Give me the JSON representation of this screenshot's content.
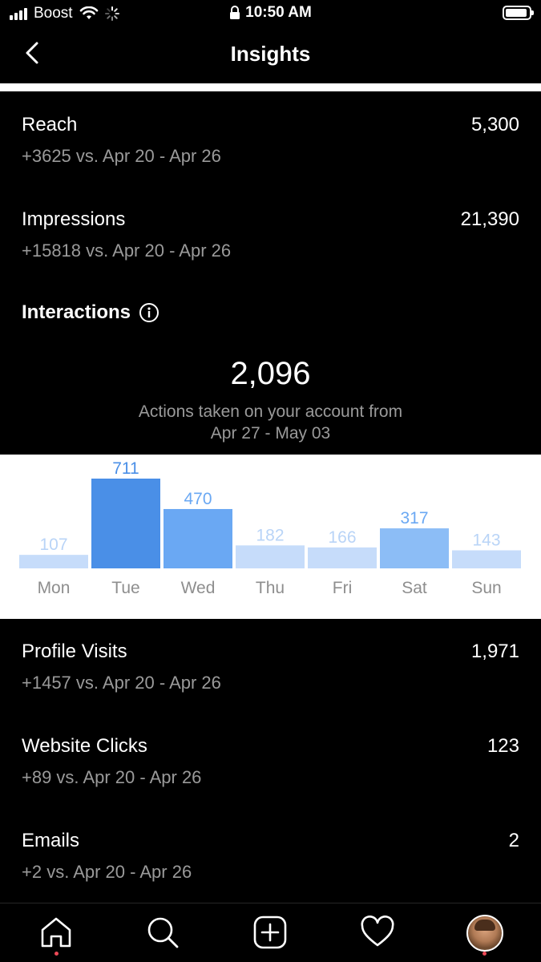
{
  "status_bar": {
    "carrier": "Boost",
    "time": "10:50 AM"
  },
  "header": {
    "title": "Insights"
  },
  "metrics_top": [
    {
      "label": "Reach",
      "value": "5,300",
      "change": "+3625 vs. Apr 20 - Apr 26"
    },
    {
      "label": "Impressions",
      "value": "21,390",
      "change": "+15818 vs. Apr 20 - Apr 26"
    }
  ],
  "interactions": {
    "title": "Interactions",
    "total": "2,096",
    "desc_line1": "Actions taken on your account from",
    "desc_line2": "Apr 27 - May 03"
  },
  "chart_data": {
    "type": "bar",
    "categories": [
      "Mon",
      "Tue",
      "Wed",
      "Thu",
      "Fri",
      "Sat",
      "Sun"
    ],
    "values": [
      107,
      711,
      470,
      182,
      166,
      317,
      143
    ],
    "colors": [
      "#c6dcfa",
      "#4a8fe7",
      "#6aa8f3",
      "#c6dcfa",
      "#c6dcfa",
      "#8cbdf6",
      "#c6dcfa"
    ],
    "label_colors": [
      "#b9d4f7",
      "#4a8fe7",
      "#6aa8f3",
      "#b9d4f7",
      "#b9d4f7",
      "#6aa8f3",
      "#b9d4f7"
    ],
    "title": "",
    "xlabel": "",
    "ylabel": ""
  },
  "metrics_bottom": [
    {
      "label": "Profile Visits",
      "value": "1,971",
      "change": "+1457 vs. Apr 20 - Apr 26"
    },
    {
      "label": "Website Clicks",
      "value": "123",
      "change": "+89 vs. Apr 20 - Apr 26"
    },
    {
      "label": "Emails",
      "value": "2",
      "change": "+2 vs. Apr 20 - Apr 26"
    }
  ],
  "icons": {
    "back": "chevron-left-icon",
    "info": "info-icon",
    "home": "home-icon",
    "search": "search-icon",
    "new_post": "plus-square-icon",
    "activity": "heart-icon",
    "profile": "avatar"
  }
}
